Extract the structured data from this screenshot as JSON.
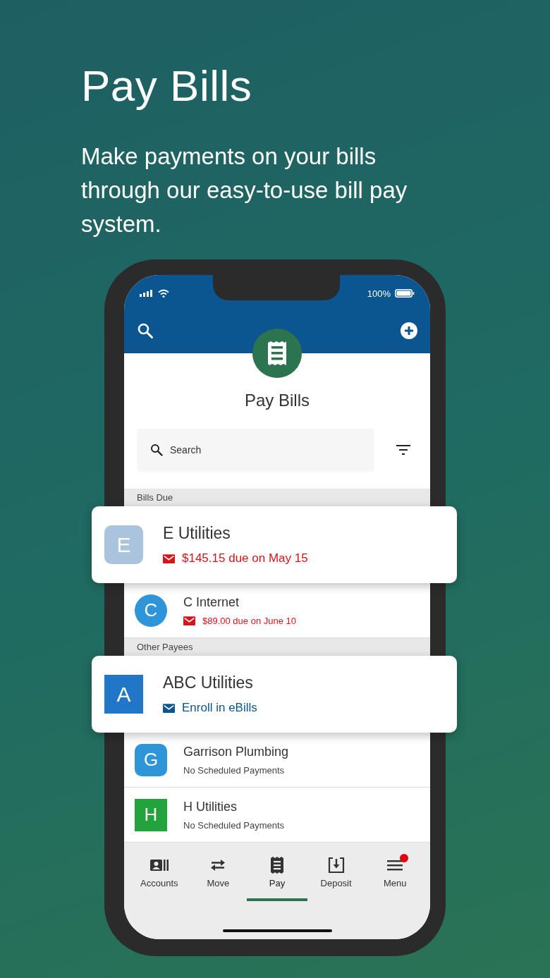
{
  "promo": {
    "title": "Pay Bills",
    "subtitle": "Make payments on your bills through our easy-to-use bill pay system."
  },
  "status_bar": {
    "battery": "100%"
  },
  "header": {
    "title": "Pay Bills"
  },
  "search": {
    "placeholder": "Search"
  },
  "sections": [
    {
      "title": "Bills Due",
      "payees": [
        {
          "initial": "E",
          "name": "E Utilities",
          "detail": "$145.15 due on May 15",
          "kind": "due",
          "highlighted": true,
          "avatar": {
            "kind": "rounded",
            "color": "#a9c4dc"
          }
        },
        {
          "initial": "C",
          "name": "C Internet",
          "detail": "$89.00 due on June 10",
          "kind": "due",
          "highlighted": false,
          "avatar": {
            "kind": "circle",
            "color": "#2f95d9"
          }
        }
      ]
    },
    {
      "title": "Other Payees",
      "payees": [
        {
          "initial": "A",
          "name": "ABC Utilities",
          "detail": "Enroll in eBills",
          "kind": "ebill",
          "highlighted": true,
          "avatar": {
            "kind": "square",
            "color": "#2176c7"
          }
        },
        {
          "initial": "G",
          "name": "Garrison Plumbing",
          "detail": "No Scheduled Payments",
          "kind": "none",
          "highlighted": false,
          "avatar": {
            "kind": "rounded",
            "color": "#2f95d9"
          }
        },
        {
          "initial": "H",
          "name": "H Utilities",
          "detail": "No Scheduled Payments",
          "kind": "none",
          "highlighted": false,
          "avatar": {
            "kind": "square",
            "color": "#22a33b"
          }
        }
      ]
    }
  ],
  "tabs": [
    {
      "label": "Accounts",
      "selected": false,
      "badge": false
    },
    {
      "label": "Move",
      "selected": false,
      "badge": false
    },
    {
      "label": "Pay",
      "selected": true,
      "badge": false
    },
    {
      "label": "Deposit",
      "selected": false,
      "badge": false
    },
    {
      "label": "Menu",
      "selected": false,
      "badge": true
    }
  ]
}
